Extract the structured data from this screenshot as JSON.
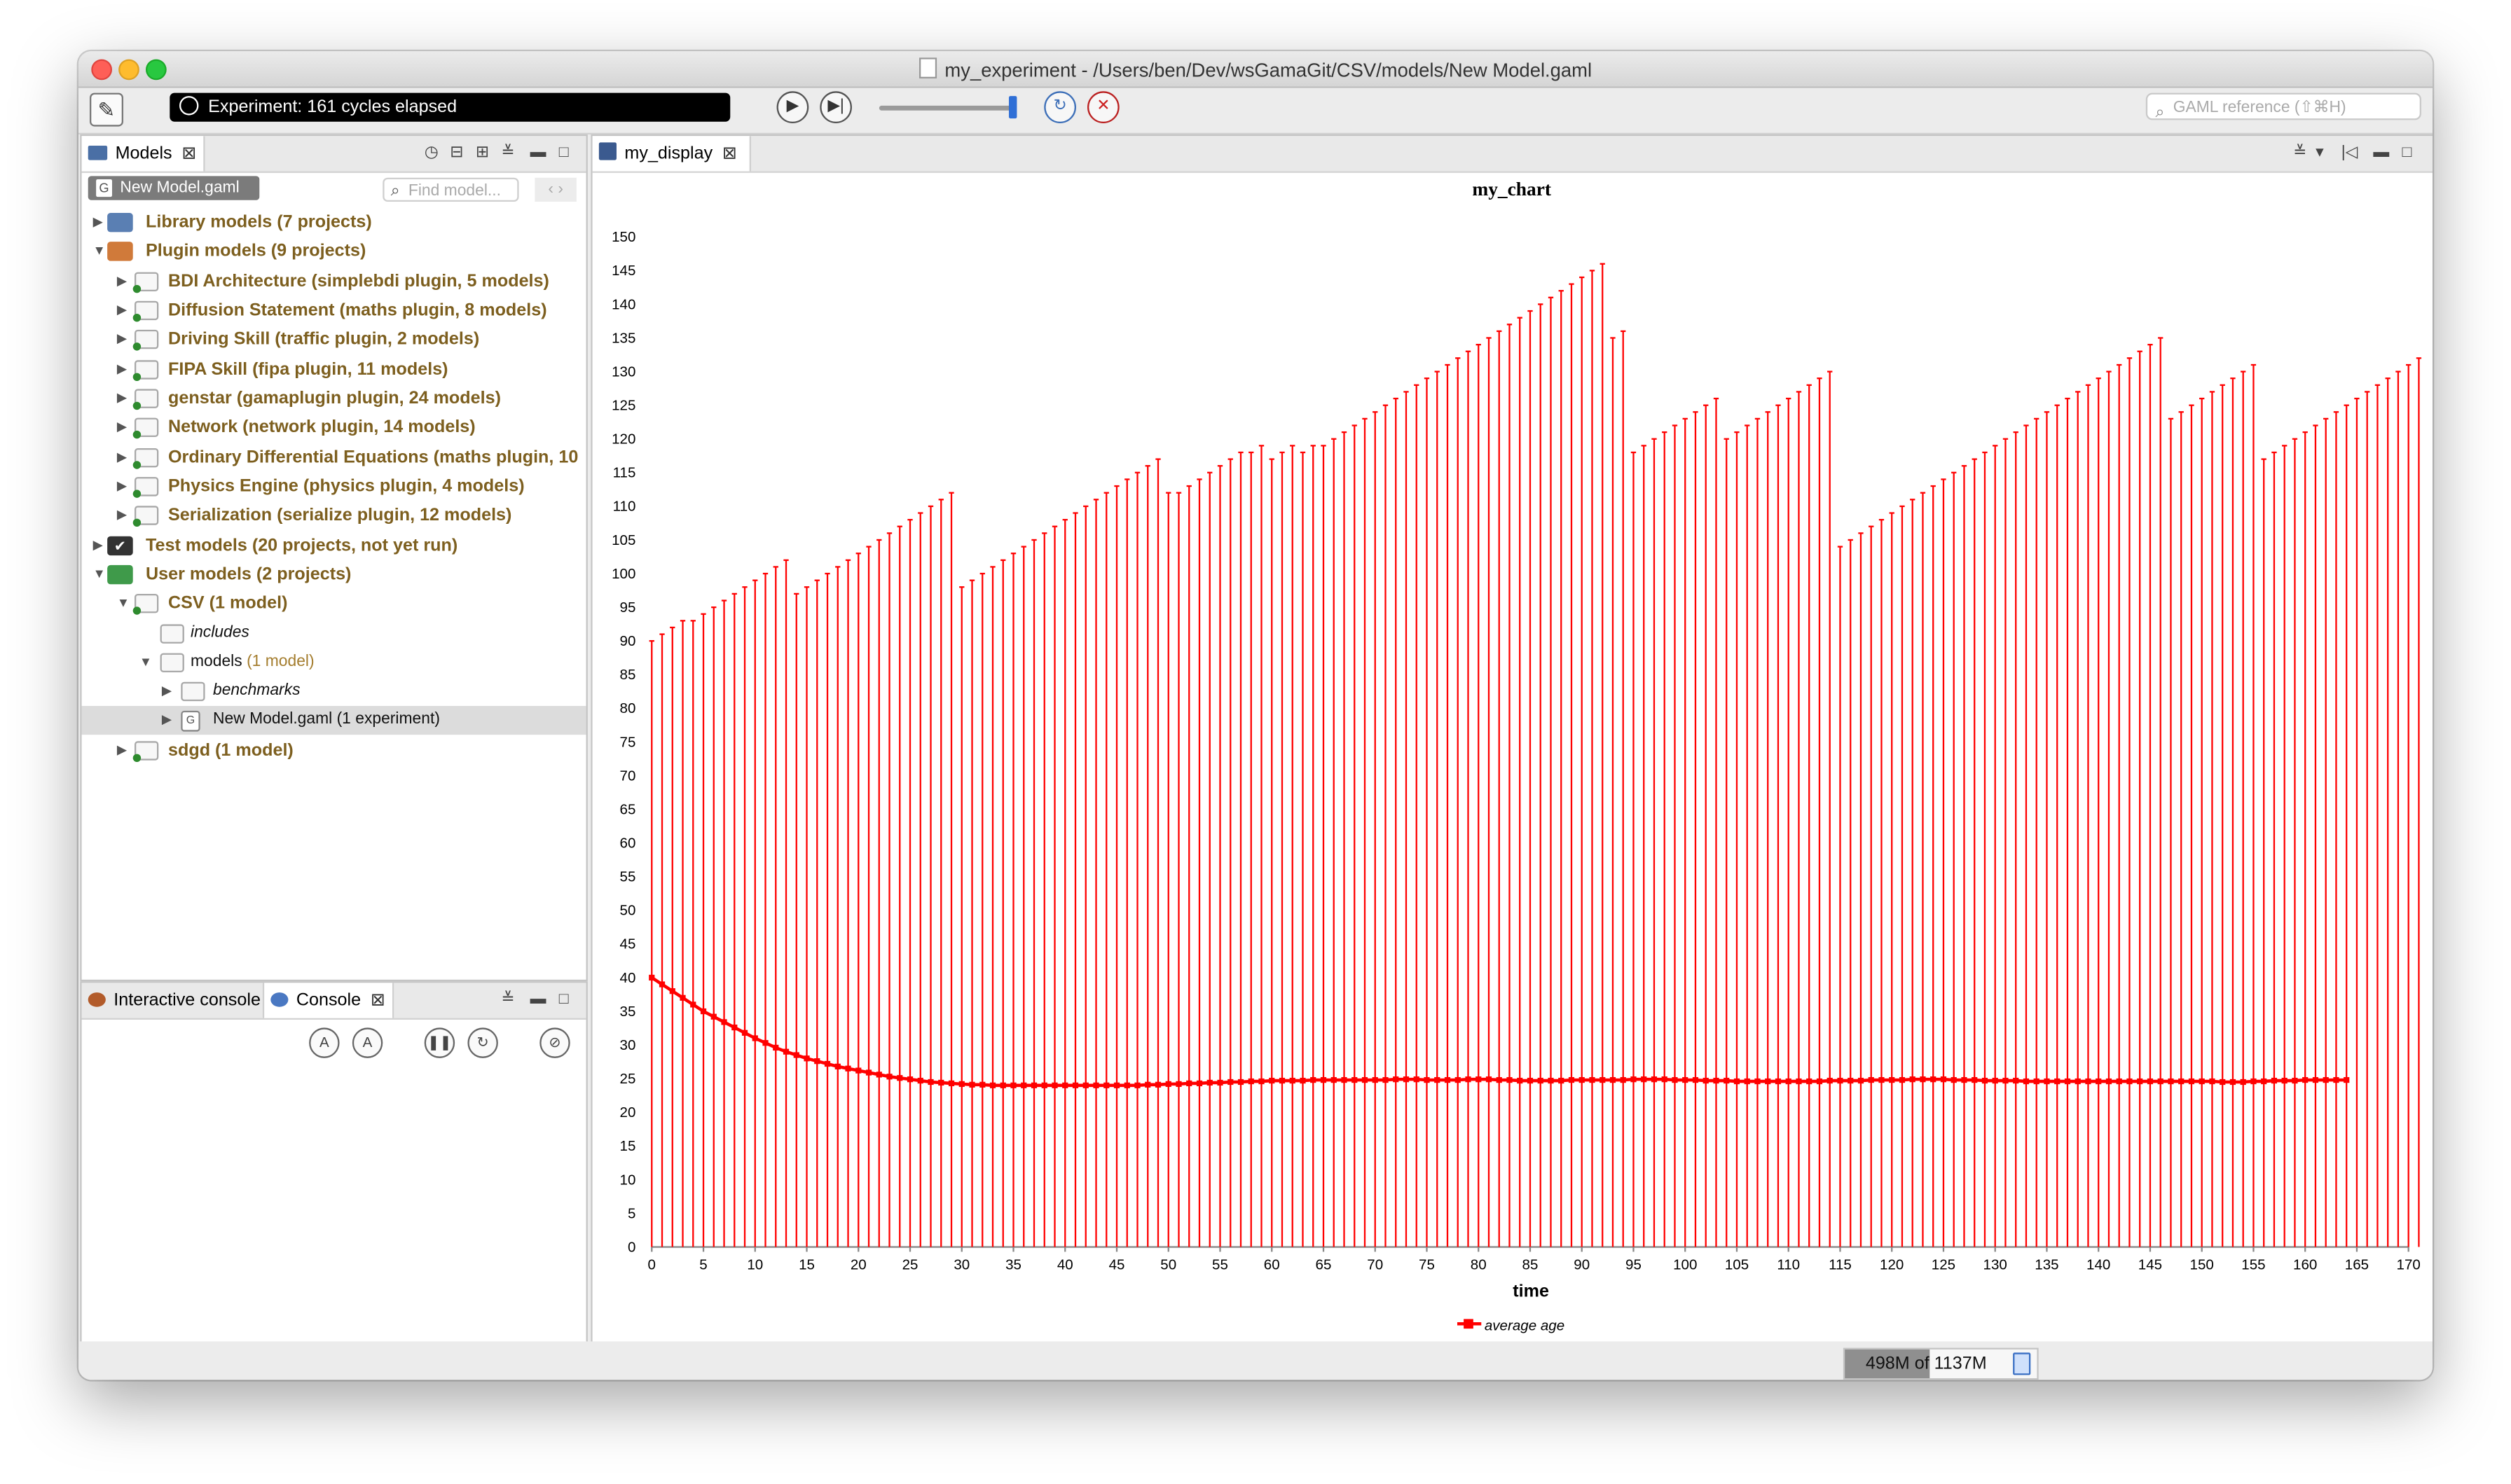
{
  "window": {
    "title": "my_experiment - /Users/ben/Dev/wsGamaGit/CSV/models/New Model.gaml"
  },
  "toolbar": {
    "status": "Experiment: 161 cycles elapsed",
    "search_placeholder": "GAML reference (⇧⌘H)"
  },
  "models_pane": {
    "tab_label": "Models",
    "chip_label": "New Model.gaml",
    "find_placeholder": "Find model...",
    "tree": [
      {
        "label": "Library models (7 projects)"
      },
      {
        "label": "Plugin models (9 projects)"
      },
      {
        "label": "BDI Architecture (simplebdi plugin, 5 models)"
      },
      {
        "label": "Diffusion Statement (maths plugin, 8 models)"
      },
      {
        "label": "Driving Skill (traffic plugin, 2 models)"
      },
      {
        "label": "FIPA Skill (fipa plugin, 11 models)"
      },
      {
        "label": "genstar (gamaplugin plugin, 24 models)"
      },
      {
        "label": "Network (network plugin, 14 models)"
      },
      {
        "label": "Ordinary Differential Equations (maths plugin, 10"
      },
      {
        "label": "Physics Engine (physics plugin, 4 models)"
      },
      {
        "label": "Serialization (serialize plugin, 12 models)"
      },
      {
        "label": "Test models (20 projects, not yet run)"
      },
      {
        "label": "User models (2 projects)"
      },
      {
        "label": "CSV (1 model)"
      },
      {
        "label": "includes"
      },
      {
        "label": "models",
        "note": "(1 model)"
      },
      {
        "label": "benchmarks"
      },
      {
        "label": "New Model.gaml (1 experiment)"
      },
      {
        "label": "sdgd (1 model)"
      }
    ]
  },
  "console_pane": {
    "tab_interactive": "Interactive console",
    "tab_console": "Console"
  },
  "display_pane": {
    "tab_label": "my_display"
  },
  "memory": {
    "text": "498M of 1137M",
    "fraction": 0.438
  },
  "colors": {
    "series": "#ff0000",
    "category_text": "#7d5f1f",
    "status_bg": "#000000"
  },
  "chart_data": {
    "type": "line",
    "title": "my_chart",
    "xlabel": "time",
    "ylabel": "",
    "xlim": [
      0,
      170
    ],
    "ylim": [
      0,
      150
    ],
    "x_ticks": [
      0,
      5,
      10,
      15,
      20,
      25,
      30,
      35,
      40,
      45,
      50,
      55,
      60,
      65,
      70,
      75,
      80,
      85,
      90,
      95,
      100,
      105,
      110,
      115,
      120,
      125,
      130,
      135,
      140,
      145,
      150,
      155,
      160,
      165,
      170
    ],
    "y_ticks": [
      0,
      5,
      10,
      15,
      20,
      25,
      30,
      35,
      40,
      45,
      50,
      55,
      60,
      65,
      70,
      75,
      80,
      85,
      90,
      95,
      100,
      105,
      110,
      115,
      120,
      125,
      130,
      135,
      140,
      145,
      150
    ],
    "legend_position": "bottom-center",
    "series": [
      {
        "name": "average age",
        "color": "#ff0000",
        "x_start": 0,
        "x_step": 1,
        "values": [
          40,
          39,
          38,
          37,
          36,
          35,
          34.2,
          33.4,
          32.6,
          31.8,
          31,
          30.3,
          29.6,
          29,
          28.5,
          28,
          27.6,
          27.2,
          26.8,
          26.5,
          26.2,
          25.9,
          25.6,
          25.3,
          25.1,
          24.9,
          24.7,
          24.5,
          24.4,
          24.3,
          24.2,
          24.1,
          24.1,
          24,
          24,
          24,
          24,
          24,
          24,
          24,
          24,
          24,
          24,
          24,
          24,
          24,
          24,
          24,
          24.1,
          24.1,
          24.2,
          24.2,
          24.3,
          24.3,
          24.4,
          24.4,
          24.5,
          24.5,
          24.6,
          24.6,
          24.7,
          24.7,
          24.7,
          24.7,
          24.8,
          24.8,
          24.8,
          24.8,
          24.8,
          24.8,
          24.8,
          24.8,
          24.9,
          24.9,
          24.9,
          24.8,
          24.8,
          24.8,
          24.8,
          24.9,
          24.9,
          24.9,
          24.8,
          24.8,
          24.7,
          24.7,
          24.7,
          24.7,
          24.7,
          24.8,
          24.8,
          24.8,
          24.8,
          24.8,
          24.8,
          24.9,
          24.9,
          24.9,
          24.9,
          24.8,
          24.8,
          24.8,
          24.7,
          24.7,
          24.7,
          24.6,
          24.6,
          24.6,
          24.6,
          24.6,
          24.6,
          24.6,
          24.6,
          24.6,
          24.7,
          24.7,
          24.7,
          24.7,
          24.8,
          24.8,
          24.8,
          24.8,
          24.9,
          24.9,
          24.9,
          24.9,
          24.8,
          24.8,
          24.8,
          24.7,
          24.7,
          24.7,
          24.7,
          24.6,
          24.6,
          24.6,
          24.6,
          24.6,
          24.6,
          24.6,
          24.6,
          24.6,
          24.6,
          24.6,
          24.6,
          24.6,
          24.6,
          24.6,
          24.6,
          24.6,
          24.6,
          24.6,
          24.5,
          24.5,
          24.5,
          24.6,
          24.6,
          24.7,
          24.7,
          24.7,
          24.8,
          24.8,
          24.8,
          24.8,
          24.8
        ],
        "error_upper": [
          90,
          91,
          92,
          93,
          93,
          94,
          95,
          96,
          97,
          98,
          99,
          100,
          101,
          102,
          97,
          98,
          99,
          100,
          101,
          102,
          103,
          104,
          105,
          106,
          107,
          108,
          109,
          110,
          111,
          112,
          98,
          99,
          100,
          101,
          102,
          103,
          104,
          105,
          106,
          107,
          108,
          109,
          110,
          111,
          112,
          113,
          114,
          115,
          116,
          117,
          112,
          112,
          113,
          114,
          115,
          116,
          117,
          118,
          118,
          119,
          117,
          118,
          119,
          118,
          119,
          119,
          120,
          121,
          122,
          123,
          124,
          125,
          126,
          127,
          128,
          129,
          130,
          131,
          132,
          133,
          134,
          135,
          136,
          137,
          138,
          139,
          140,
          141,
          142,
          143,
          144,
          145,
          146,
          135,
          136,
          118,
          119,
          120,
          121,
          122,
          123,
          124,
          125,
          126,
          120,
          121,
          122,
          123,
          124,
          125,
          126,
          127,
          128,
          129,
          130,
          104,
          105,
          106,
          107,
          108,
          109,
          110,
          111,
          112,
          113,
          114,
          115,
          116,
          117,
          118,
          119,
          120,
          121,
          122,
          123,
          124,
          125,
          126,
          127,
          128,
          129,
          130,
          131,
          132,
          133,
          134,
          135,
          123,
          124,
          125,
          126,
          127,
          128,
          129,
          130,
          131,
          117,
          118,
          119,
          120,
          121,
          122,
          123,
          124,
          125,
          126,
          127,
          128,
          129,
          130,
          131,
          132
        ]
      }
    ]
  }
}
